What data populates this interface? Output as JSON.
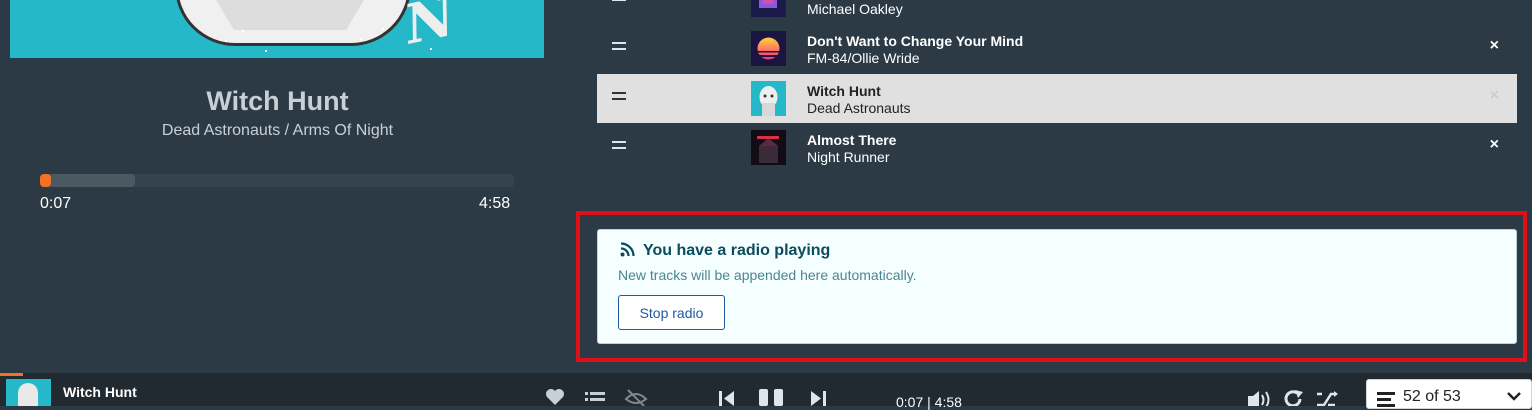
{
  "now_playing": {
    "title": "Witch Hunt",
    "subtitle": "Dead Astronauts / Arms Of Night",
    "current_time": "0:07",
    "total_time": "4:58",
    "progress_fraction": 0.0235
  },
  "queue": {
    "items": [
      {
        "title": "",
        "artist": "Michael Oakley",
        "active": false
      },
      {
        "title": "Don't Want to Change Your Mind",
        "artist": "FM-84/Ollie Wride",
        "active": false
      },
      {
        "title": "Witch Hunt",
        "artist": "Dead Astronauts",
        "active": true
      },
      {
        "title": "Almost There",
        "artist": "Night Runner",
        "active": false
      }
    ],
    "remove_glyph": "×"
  },
  "radio_notice": {
    "heading": "You have a radio playing",
    "description": "New tracks will be appended here automatically.",
    "stop_label": "Stop radio",
    "icon": "rss-icon"
  },
  "player_bar": {
    "track_title": "Witch Hunt",
    "time_display": "0:07 | 4:58",
    "queue_position": "52 of 53"
  },
  "colors": {
    "accent": "#f37024",
    "background": "#2b3a45",
    "highlight_border": "#e0101a"
  }
}
